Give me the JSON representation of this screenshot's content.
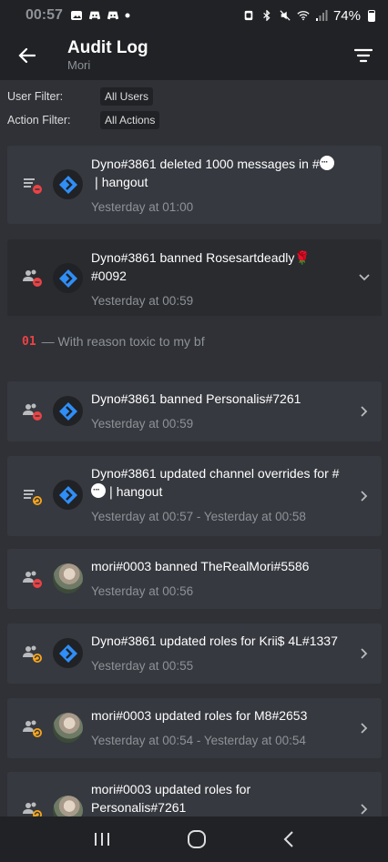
{
  "status_bar": {
    "time": "00:57",
    "battery": "74%"
  },
  "header": {
    "title": "Audit Log",
    "subtitle": "Mori"
  },
  "filters": {
    "user_label": "User Filter:",
    "user_value": "All Users",
    "action_label": "Action Filter:",
    "action_value": "All Actions"
  },
  "entries": [
    {
      "line1": "Dyno#3861 deleted 1000 messages in #",
      "line2": "❘hangout",
      "time": "Yesterday at 01:00"
    },
    {
      "line1": "Dyno#3861 banned Rosesartdeadly🌹",
      "line2": "#0092",
      "time": "Yesterday at 00:59",
      "reason_num": "01",
      "reason_text": "— With reason toxic to my bf"
    },
    {
      "line1": "Dyno#3861 banned Personalis#7261",
      "time": "Yesterday at 00:59"
    },
    {
      "line1": "Dyno#3861 updated channel overrides for #",
      "line2": "❘hangout",
      "time": "Yesterday at 00:57 - Yesterday at 00:58"
    },
    {
      "line1": "mori#0003 banned TheRealMori#5586",
      "time": "Yesterday at 00:56"
    },
    {
      "line1": "Dyno#3861 updated roles for Krii$ 4L#1337",
      "time": "Yesterday at 00:55"
    },
    {
      "line1": "mori#0003 updated roles for M8#2653",
      "time": "Yesterday at 00:54 - Yesterday at 00:54"
    },
    {
      "line1": "mori#0003 updated roles for",
      "line2": "Personalis#7261"
    }
  ],
  "colors": {
    "accent": "#ed4245",
    "update": "#faa61a",
    "dyno": "#2f8ef7"
  }
}
